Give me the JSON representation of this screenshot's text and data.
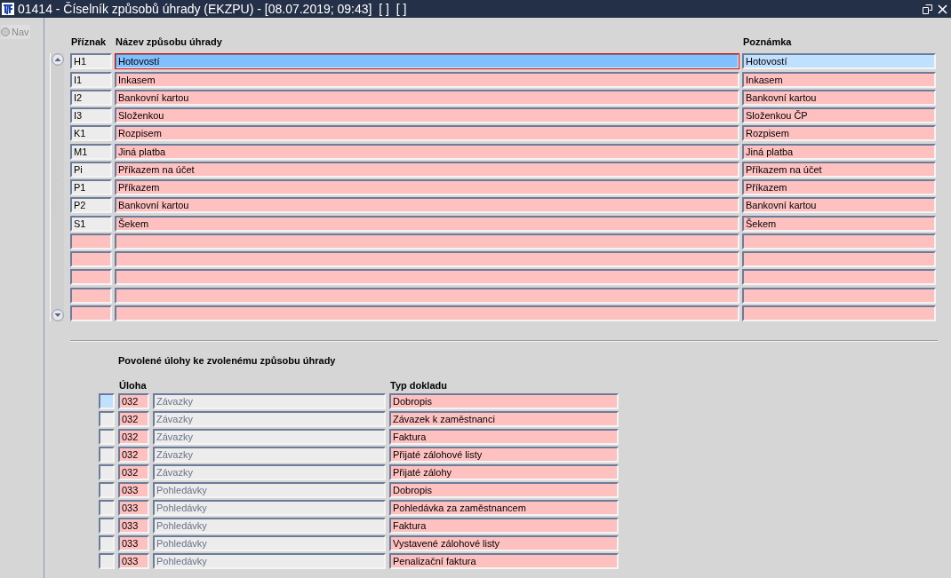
{
  "window": {
    "title": "01414 - Číselník způsobů úhrady (EKZPU) - [08.07.2019; 09:43]  [ ]  [ ]"
  },
  "sidebar": {
    "nav": {
      "label": "Nav",
      "selected": false
    }
  },
  "payment_methods": {
    "columns": [
      "Příznak",
      "Název způsobu úhrady",
      "Poznámka"
    ],
    "rows": [
      {
        "code": "H1",
        "name": "Hotovostí",
        "note": "Hotovostí",
        "selected": true
      },
      {
        "code": "I1",
        "name": "Inkasem",
        "note": "Inkasem",
        "selected": false
      },
      {
        "code": "I2",
        "name": "Bankovní kartou",
        "note": "Bankovní kartou",
        "selected": false
      },
      {
        "code": "I3",
        "name": "Složenkou",
        "note": "Složenkou ČP",
        "selected": false
      },
      {
        "code": "K1",
        "name": "Rozpisem",
        "note": "Rozpisem",
        "selected": false
      },
      {
        "code": "M1",
        "name": "Jiná platba",
        "note": "Jiná platba",
        "selected": false
      },
      {
        "code": "Pi",
        "name": "Příkazem na účet",
        "note": "Příkazem na účet",
        "selected": false
      },
      {
        "code": "P1",
        "name": "Příkazem",
        "note": "Příkazem",
        "selected": false
      },
      {
        "code": "P2",
        "name": "Bankovní kartou",
        "note": "Bankovní kartou",
        "selected": false
      },
      {
        "code": "S1",
        "name": "Šekem",
        "note": "Šekem",
        "selected": false
      }
    ]
  },
  "allowed_tasks": {
    "title": "Povolené úlohy ke zvolenému způsobu úhrady",
    "columns": [
      "Úloha",
      "Typ dokladu"
    ],
    "rows": [
      {
        "code": "032",
        "task": "Závazky",
        "doc_type": "Dobropis",
        "selected": true
      },
      {
        "code": "032",
        "task": "Závazky",
        "doc_type": "Závazek k zaměstnanci",
        "selected": false
      },
      {
        "code": "032",
        "task": "Závazky",
        "doc_type": "Faktura",
        "selected": false
      },
      {
        "code": "032",
        "task": "Závazky",
        "doc_type": "Přijaté zálohové listy",
        "selected": false
      },
      {
        "code": "032",
        "task": "Závazky",
        "doc_type": "Přijaté zálohy",
        "selected": false
      },
      {
        "code": "033",
        "task": "Pohledávky",
        "doc_type": "Dobropis",
        "selected": false
      },
      {
        "code": "033",
        "task": "Pohledávky",
        "doc_type": "Pohledávka za zaměstnancem",
        "selected": false
      },
      {
        "code": "033",
        "task": "Pohledávky",
        "doc_type": "Faktura",
        "selected": false
      },
      {
        "code": "033",
        "task": "Pohledávky",
        "doc_type": "Vystavené zálohové listy",
        "selected": false
      },
      {
        "code": "033",
        "task": "Pohledávky",
        "doc_type": "Penalizační faktura",
        "selected": false
      }
    ]
  }
}
